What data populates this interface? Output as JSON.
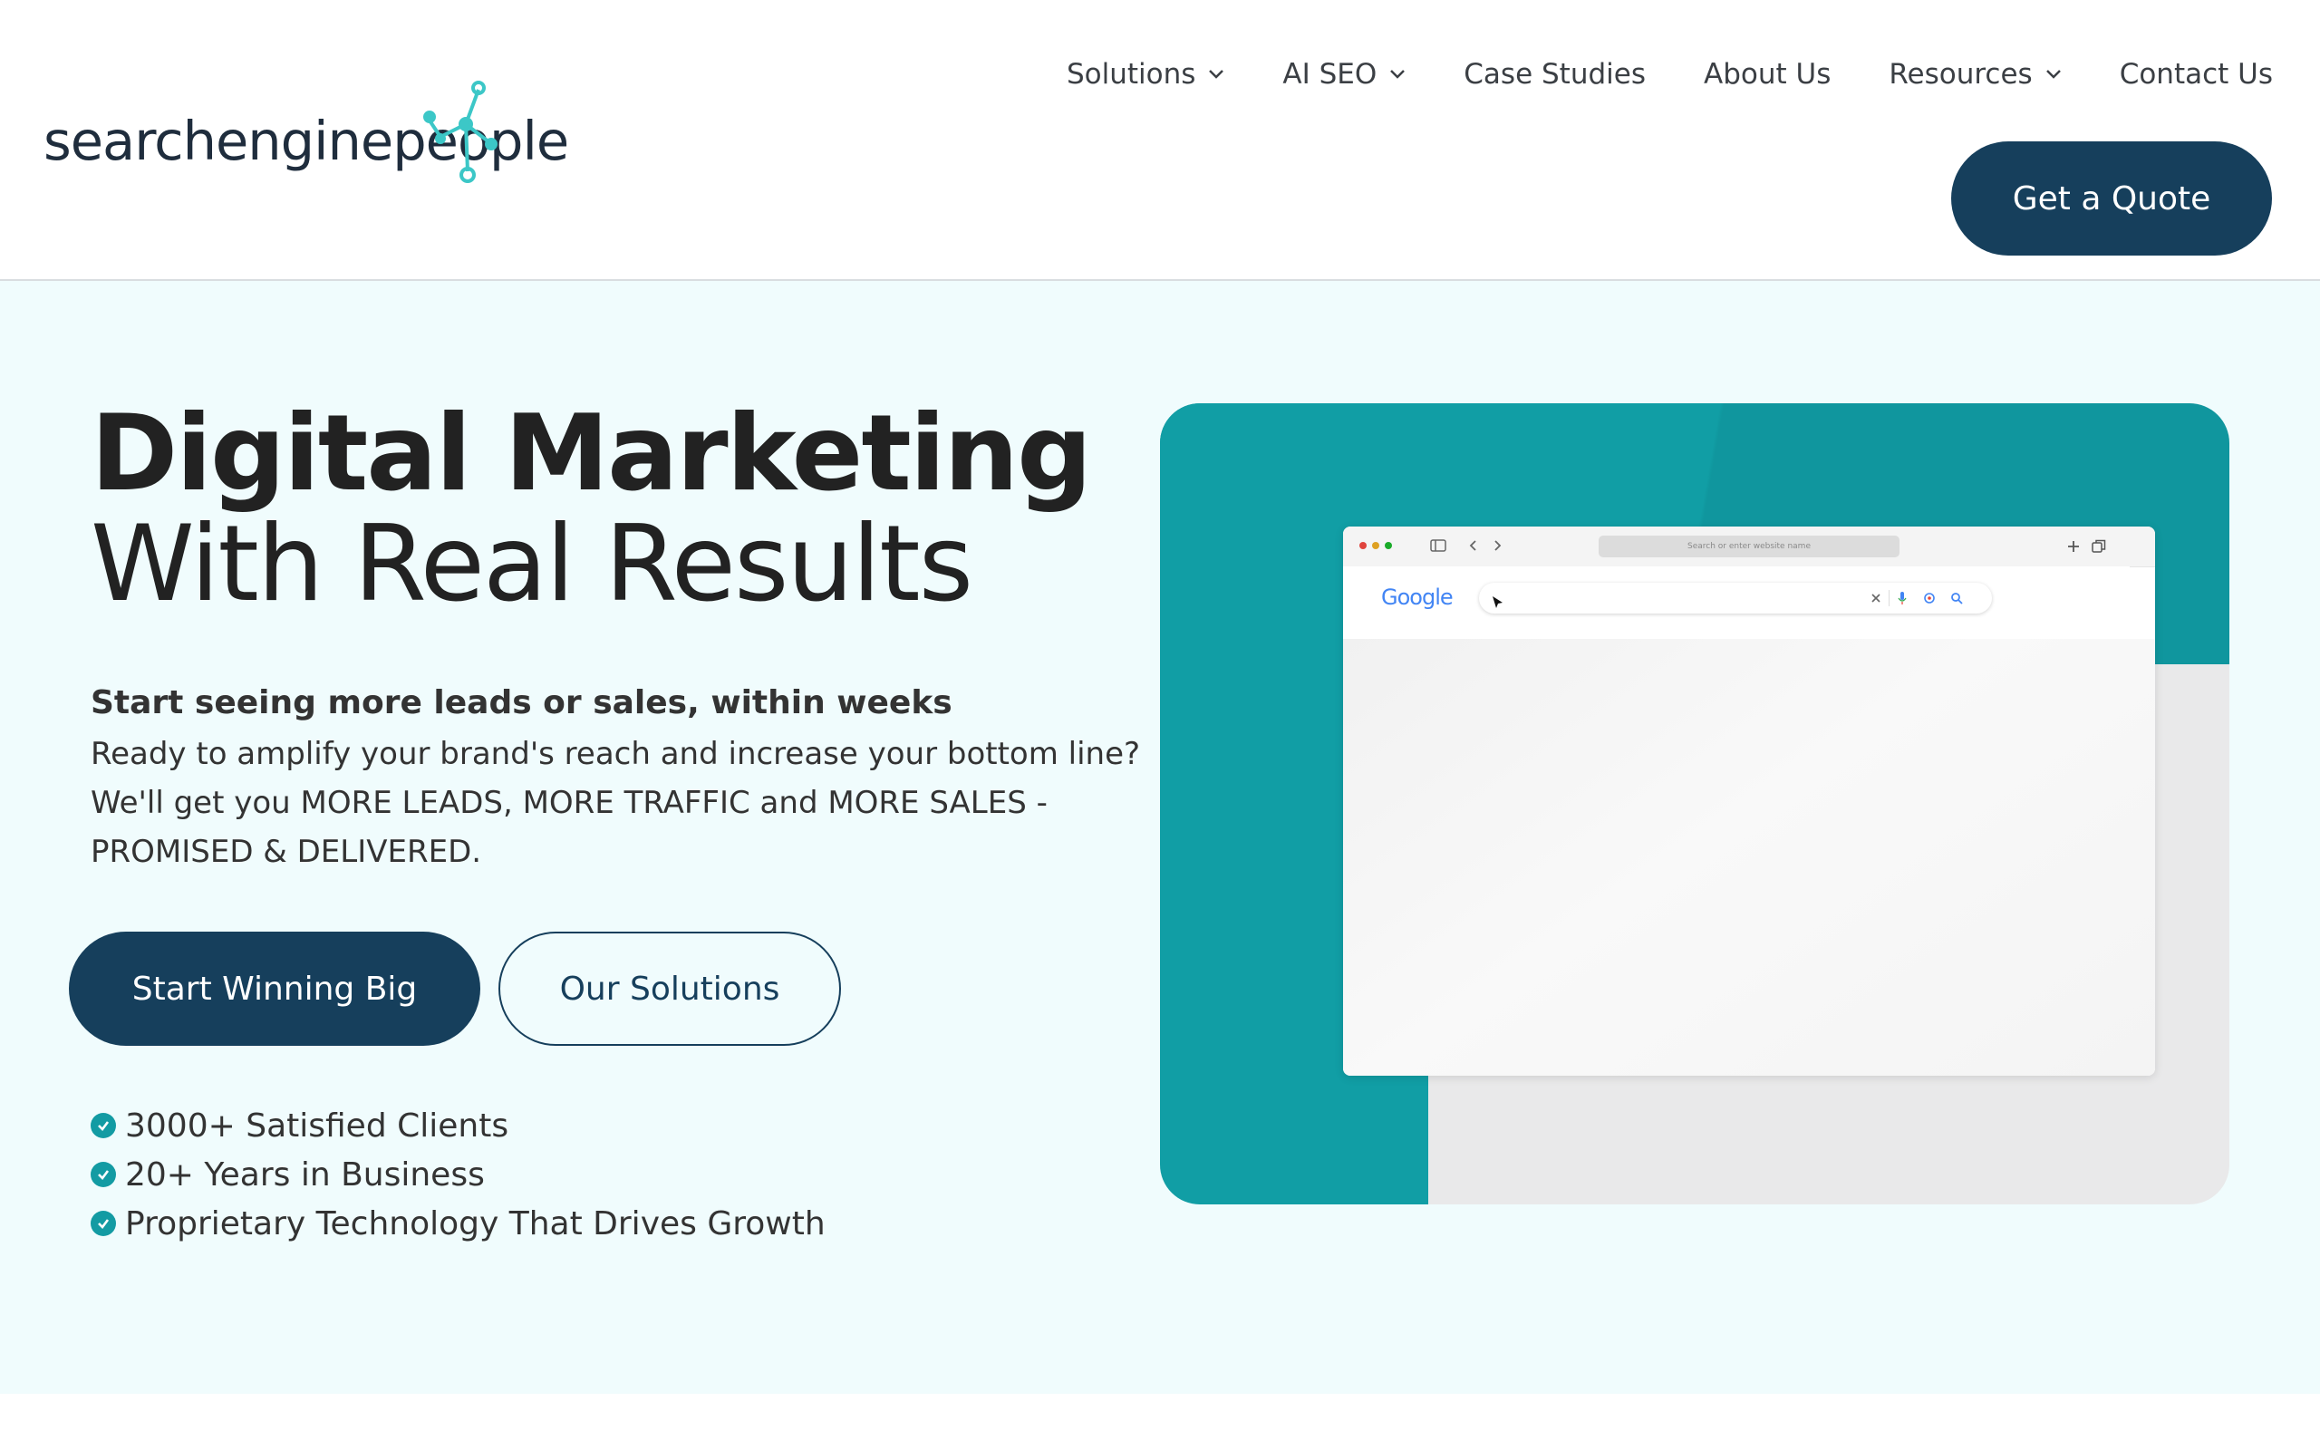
{
  "brand": {
    "name": "searchenginepeople"
  },
  "nav": {
    "items": [
      {
        "label": "Solutions",
        "has_dropdown": true
      },
      {
        "label": "AI SEO",
        "has_dropdown": true
      },
      {
        "label": "Case Studies",
        "has_dropdown": false
      },
      {
        "label": "About Us",
        "has_dropdown": false
      },
      {
        "label": "Resources",
        "has_dropdown": true
      },
      {
        "label": "Contact Us",
        "has_dropdown": false
      }
    ],
    "cta_label": "Get a Quote"
  },
  "hero": {
    "title": "Digital Marketing",
    "subtitle": "With Real Results",
    "lead_strong": "Start seeing more leads or sales, within weeks",
    "lead_text": "Ready to amplify your brand's reach and increase your bottom line? We'll get you MORE LEADS, MORE TRAFFIC and MORE SALES - PROMISED & DELIVERED.",
    "primary_button": "Start Winning Big",
    "secondary_button": "Our Solutions",
    "bullets": [
      "3000+ Satisfied Clients",
      "20+ Years in Business",
      "Proprietary Technology That Drives Growth"
    ]
  },
  "illustration": {
    "address_placeholder": "Search or enter website name",
    "search_engine_logo": "Google"
  },
  "colors": {
    "navy": "#163f5c",
    "teal": "#119ea5",
    "hero_bg": "#f0fcfd",
    "logo_accent": "#3cc7c7"
  }
}
